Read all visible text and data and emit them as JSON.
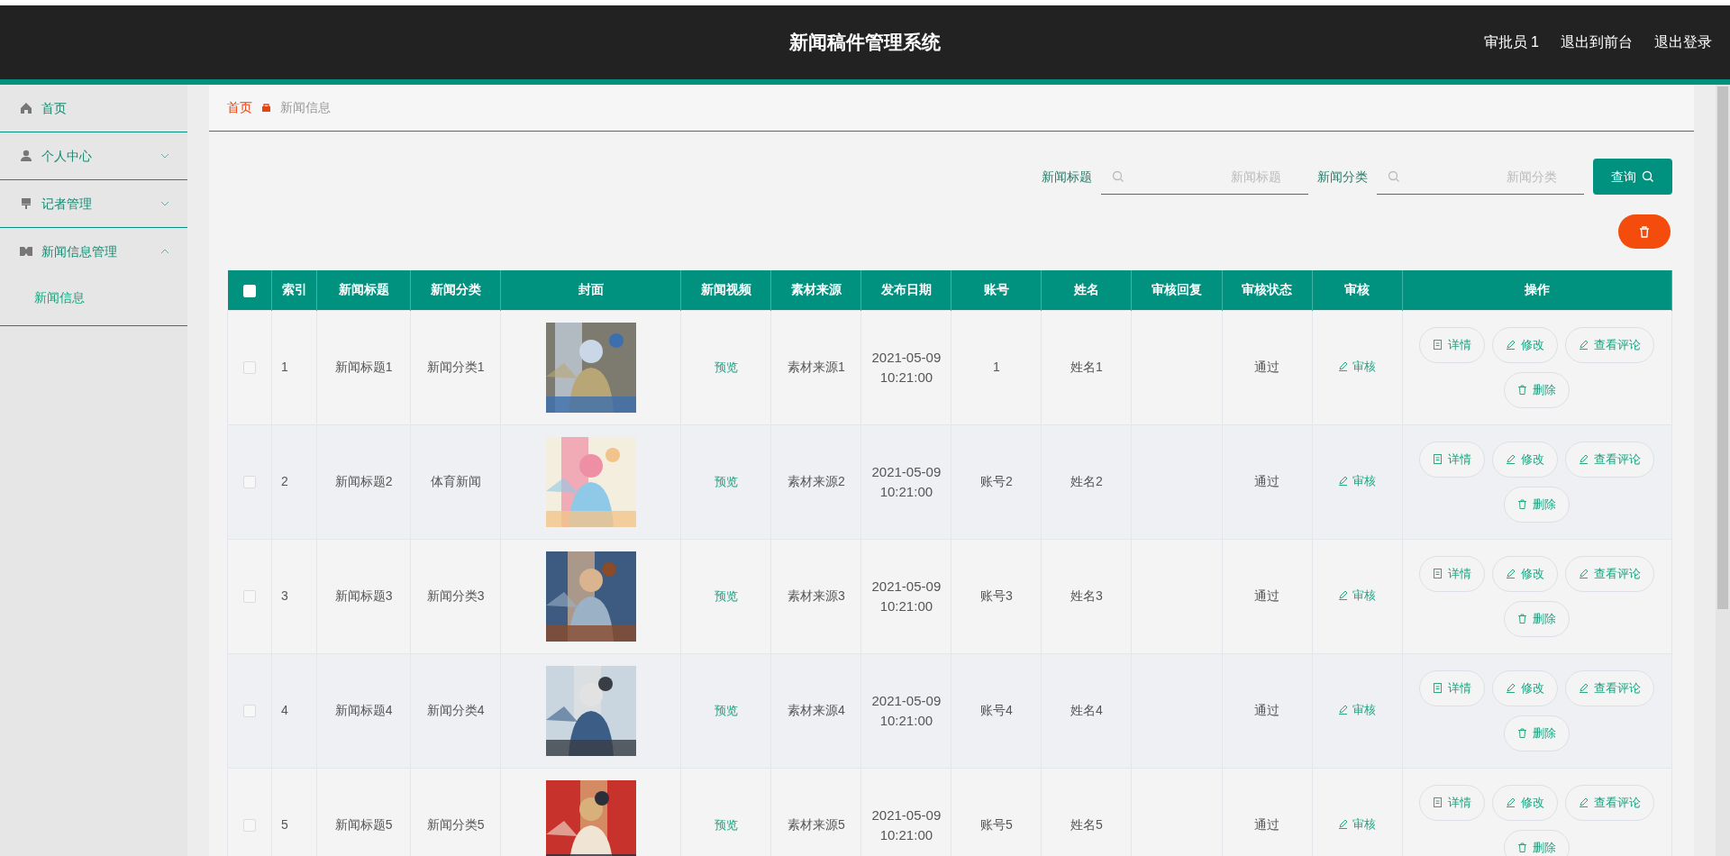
{
  "header": {
    "title": "新闻稿件管理系统",
    "links": [
      "审批员 1",
      "退出到前台",
      "退出登录"
    ]
  },
  "sidebar": {
    "items": [
      {
        "label": "首页"
      },
      {
        "label": "个人中心",
        "expanded": false
      },
      {
        "label": "记者管理",
        "expanded": false
      },
      {
        "label": "新闻信息管理",
        "expanded": true,
        "children": [
          {
            "label": "新闻信息"
          }
        ]
      }
    ]
  },
  "breadcrumb": [
    "首页",
    "新闻信息"
  ],
  "search": {
    "fields": [
      {
        "label": "新闻标题",
        "placeholder": "新闻标题"
      },
      {
        "label": "新闻分类",
        "placeholder": "新闻分类"
      }
    ],
    "button": "查询"
  },
  "table": {
    "header_checked": false,
    "columns": [
      "索引",
      "新闻标题",
      "新闻分类",
      "封面",
      "新闻视频",
      "素材来源",
      "发布日期",
      "账号",
      "姓名",
      "审核回复",
      "审核状态",
      "审核",
      "操作"
    ],
    "rows": [
      {
        "checked": false,
        "index": "1",
        "title": "新闻标题1",
        "category": "新闻分类1",
        "cover": {
          "kind": "picture"
        },
        "video": "预览",
        "source": "素材来源1",
        "date": "2021-05-09\n10:21:00",
        "account": "1",
        "name": "姓名1",
        "status": "通过",
        "review": "审核",
        "actions": [
          "详情",
          "修改",
          "查看评论",
          "删除"
        ]
      },
      {
        "checked": false,
        "index": "2",
        "title": "新闻标题2",
        "category": "体育新闻",
        "cover": {
          "kind": "picture"
        },
        "video": "预览",
        "source": "素材来源2",
        "date": "2021-05-09\n10:21:00",
        "account": "账号2",
        "name": "姓名2",
        "status": "通过",
        "review": "审核",
        "actions": [
          "详情",
          "修改",
          "查看评论",
          "删除"
        ]
      },
      {
        "checked": false,
        "index": "3",
        "title": "新闻标题3",
        "category": "新闻分类3",
        "cover": {
          "kind": "picture"
        },
        "video": "预览",
        "source": "素材来源3",
        "date": "2021-05-09\n10:21:00",
        "account": "账号3",
        "name": "姓名3",
        "status": "通过",
        "review": "审核",
        "actions": [
          "详情",
          "修改",
          "查看评论",
          "删除"
        ]
      },
      {
        "checked": false,
        "index": "4",
        "title": "新闻标题4",
        "category": "新闻分类4",
        "cover": {
          "kind": "picture"
        },
        "video": "预览",
        "source": "素材来源4",
        "date": "2021-05-09\n10:21:00",
        "account": "账号4",
        "name": "姓名4",
        "status": "通过",
        "review": "审核",
        "actions": [
          "详情",
          "修改",
          "查看评论",
          "删除"
        ]
      },
      {
        "checked": false,
        "index": "5",
        "title": "新闻标题5",
        "category": "新闻分类5",
        "cover": {
          "kind": "picture"
        },
        "video": "预览",
        "source": "素材来源5",
        "date": "2021-05-09\n10:21:00",
        "account": "账号5",
        "name": "姓名5",
        "status": "通过",
        "review": "审核",
        "actions": [
          "详情",
          "修改",
          "查看评论",
          "删除"
        ]
      }
    ]
  }
}
